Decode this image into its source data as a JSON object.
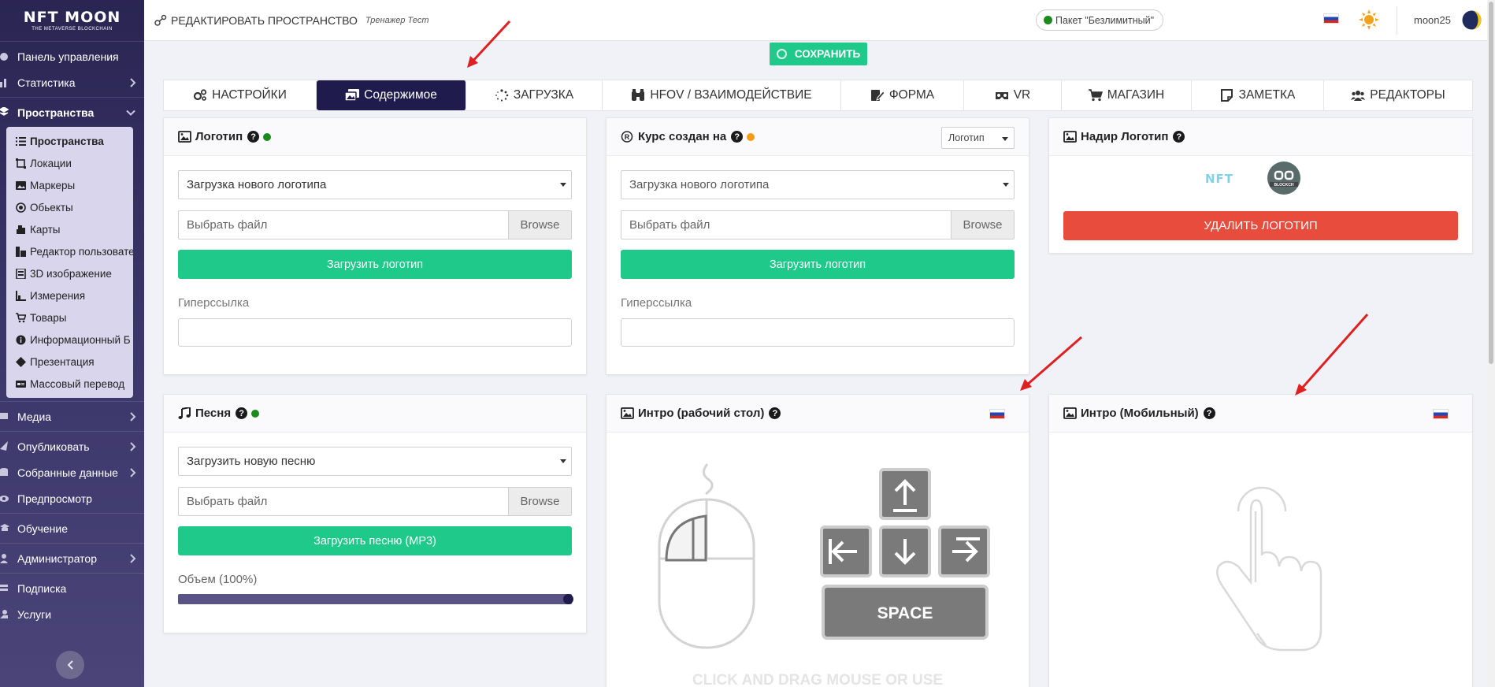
{
  "brand": {
    "logo_line1": "NFT MOON",
    "logo_line2": "THE METAVERSE BLOCKCHAIN"
  },
  "sidebar": {
    "items_top": [
      {
        "label": "Панель управления",
        "icon": "dashboard-icon"
      },
      {
        "label": "Статистика",
        "icon": "stats-icon",
        "chevron": true
      },
      {
        "label": "Пространства",
        "icon": "spaces-icon",
        "chevron": true,
        "active": true
      }
    ],
    "submenu": [
      {
        "label": "Пространства",
        "icon": "list-icon",
        "active": true
      },
      {
        "label": "Локации",
        "icon": "location-icon"
      },
      {
        "label": "Маркеры",
        "icon": "marker-icon"
      },
      {
        "label": "Обьекты",
        "icon": "object-icon"
      },
      {
        "label": "Карты",
        "icon": "map-icon"
      },
      {
        "label": "Редактор пользовате",
        "icon": "user-editor-icon"
      },
      {
        "label": "3D изображение",
        "icon": "image-3d-icon"
      },
      {
        "label": "Измерения",
        "icon": "measure-icon"
      },
      {
        "label": "Товары",
        "icon": "cart-icon"
      },
      {
        "label": "Информационный Б",
        "icon": "info-icon"
      },
      {
        "label": "Презентация",
        "icon": "presentation-icon"
      },
      {
        "label": "Массовый перевод",
        "icon": "translate-icon"
      }
    ],
    "items_bottom": [
      {
        "label": "Медиа",
        "icon": "media-icon",
        "chevron": true
      },
      {
        "label": "Опубликовать",
        "icon": "publish-icon",
        "chevron": true
      },
      {
        "label": "Собранные данные",
        "icon": "data-icon",
        "chevron": true
      },
      {
        "label": "Предпросмотр",
        "icon": "preview-icon"
      },
      {
        "label": "Обучение",
        "icon": "learning-icon"
      },
      {
        "label": "Администратор",
        "icon": "admin-icon",
        "chevron": true
      },
      {
        "label": "Подписка",
        "icon": "subscription-icon"
      },
      {
        "label": "Услуги",
        "icon": "services-icon"
      }
    ]
  },
  "header": {
    "title": "РЕДАКТИРОВАТЬ ПРОСТРАНСТВО",
    "subtitle": "Тренажер Тест",
    "package": "Пакет \"Безлимитный\"",
    "username": "moon25"
  },
  "save_label": "СОХРАНИТЬ",
  "tabs": [
    {
      "label": "НАСТРОЙКИ",
      "icon": "cogs-icon"
    },
    {
      "label": "Содержимое",
      "icon": "images-icon",
      "active": true
    },
    {
      "label": "ЗАГРУЗКА",
      "icon": "spinner-icon"
    },
    {
      "label": "HFOV / ВЗАИМОДЕЙСТВИЕ",
      "icon": "binoculars-icon"
    },
    {
      "label": "ФОРМА",
      "icon": "form-icon"
    },
    {
      "label": "VR",
      "icon": "vr-icon"
    },
    {
      "label": "МАГАЗИН",
      "icon": "cart-icon"
    },
    {
      "label": "ЗАМЕТКА",
      "icon": "note-icon"
    },
    {
      "label": "РЕДАКТОРЫ",
      "icon": "users-icon"
    }
  ],
  "logo_card": {
    "title": "Логотип",
    "status_color": "#1a8a1a",
    "select_value": "Загрузка нового логотипа",
    "file_placeholder": "Выбрать файл",
    "browse": "Browse",
    "upload_btn": "Загрузить логотип",
    "link_label": "Гиперссылка"
  },
  "course_card": {
    "title": "Курс создан на",
    "status_color": "#f39c12",
    "mini_select": "Логотип",
    "select_value": "Загрузка нового логотипа",
    "file_placeholder": "Выбрать файл",
    "browse": "Browse",
    "upload_btn": "Загрузить логотип",
    "link_label": "Гиперссылка"
  },
  "footer_logo_card": {
    "title": "Надир Логотип",
    "delete_btn": "УДАЛИТЬ ЛОГОТИП",
    "logo_text": "NFT",
    "badge_text": "BLOCKCH"
  },
  "song_card": {
    "title": "Песня",
    "status_color": "#1a8a1a",
    "select_value": "Загрузить новую песню",
    "file_placeholder": "Выбрать файл",
    "browse": "Browse",
    "upload_btn": "Загрузить песню (MP3)",
    "volume_label": "Объем (100%)",
    "volume": 1.0
  },
  "intro_desktop": {
    "title": "Интро (рабочий стол)",
    "space_key": "SPACE",
    "caption": "CLICK AND DRAG MOUSE OR USE"
  },
  "intro_mobile": {
    "title": "Интро (Мобильный)"
  },
  "colors": {
    "accent": "#1fc98a",
    "danger": "#e74c3c",
    "tab_active": "#1f1b4d",
    "sidebar": "#2a2552"
  }
}
